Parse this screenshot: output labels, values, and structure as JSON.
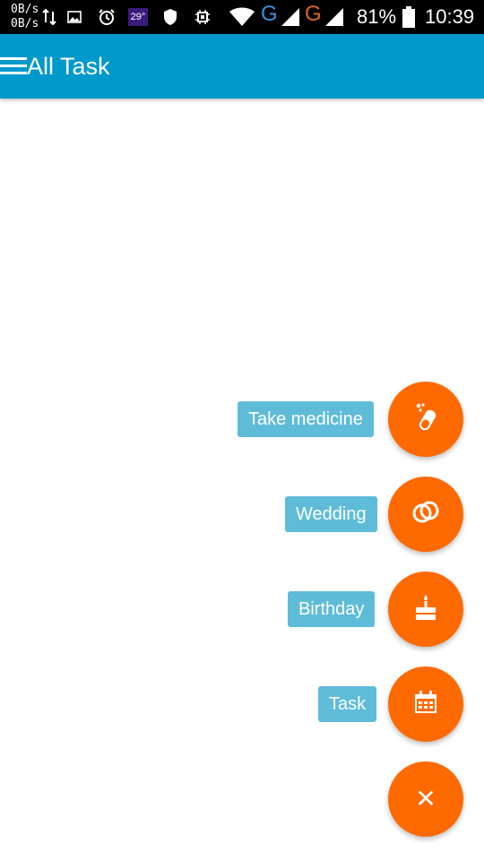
{
  "status_bar": {
    "speed_up": "0B/s",
    "speed_down": "0B/s",
    "temperature": "29°",
    "network_1": "G",
    "network_2": "G",
    "battery": "81%",
    "time": "10:39",
    "icons": [
      "data-transfer-icon",
      "image-icon",
      "alarm-icon",
      "weather-icon",
      "shield-icon",
      "chip-icon",
      "wifi-icon",
      "signal-icon",
      "signal-icon",
      "battery-icon"
    ]
  },
  "app_bar": {
    "title": "All Task",
    "menu_icon": "hamburger-menu-icon"
  },
  "fab_menu": {
    "items": [
      {
        "label": "Take medicine",
        "icon": "medicine-icon"
      },
      {
        "label": "Wedding",
        "icon": "rings-icon"
      },
      {
        "label": "Birthday",
        "icon": "cake-icon"
      },
      {
        "label": "Task",
        "icon": "calendar-icon"
      }
    ],
    "close_icon": "close-icon"
  },
  "colors": {
    "app_bar": "#0099cc",
    "fab": "#ff6a00",
    "label_bg": "#5fbcd9",
    "status_bar": "#000000"
  }
}
